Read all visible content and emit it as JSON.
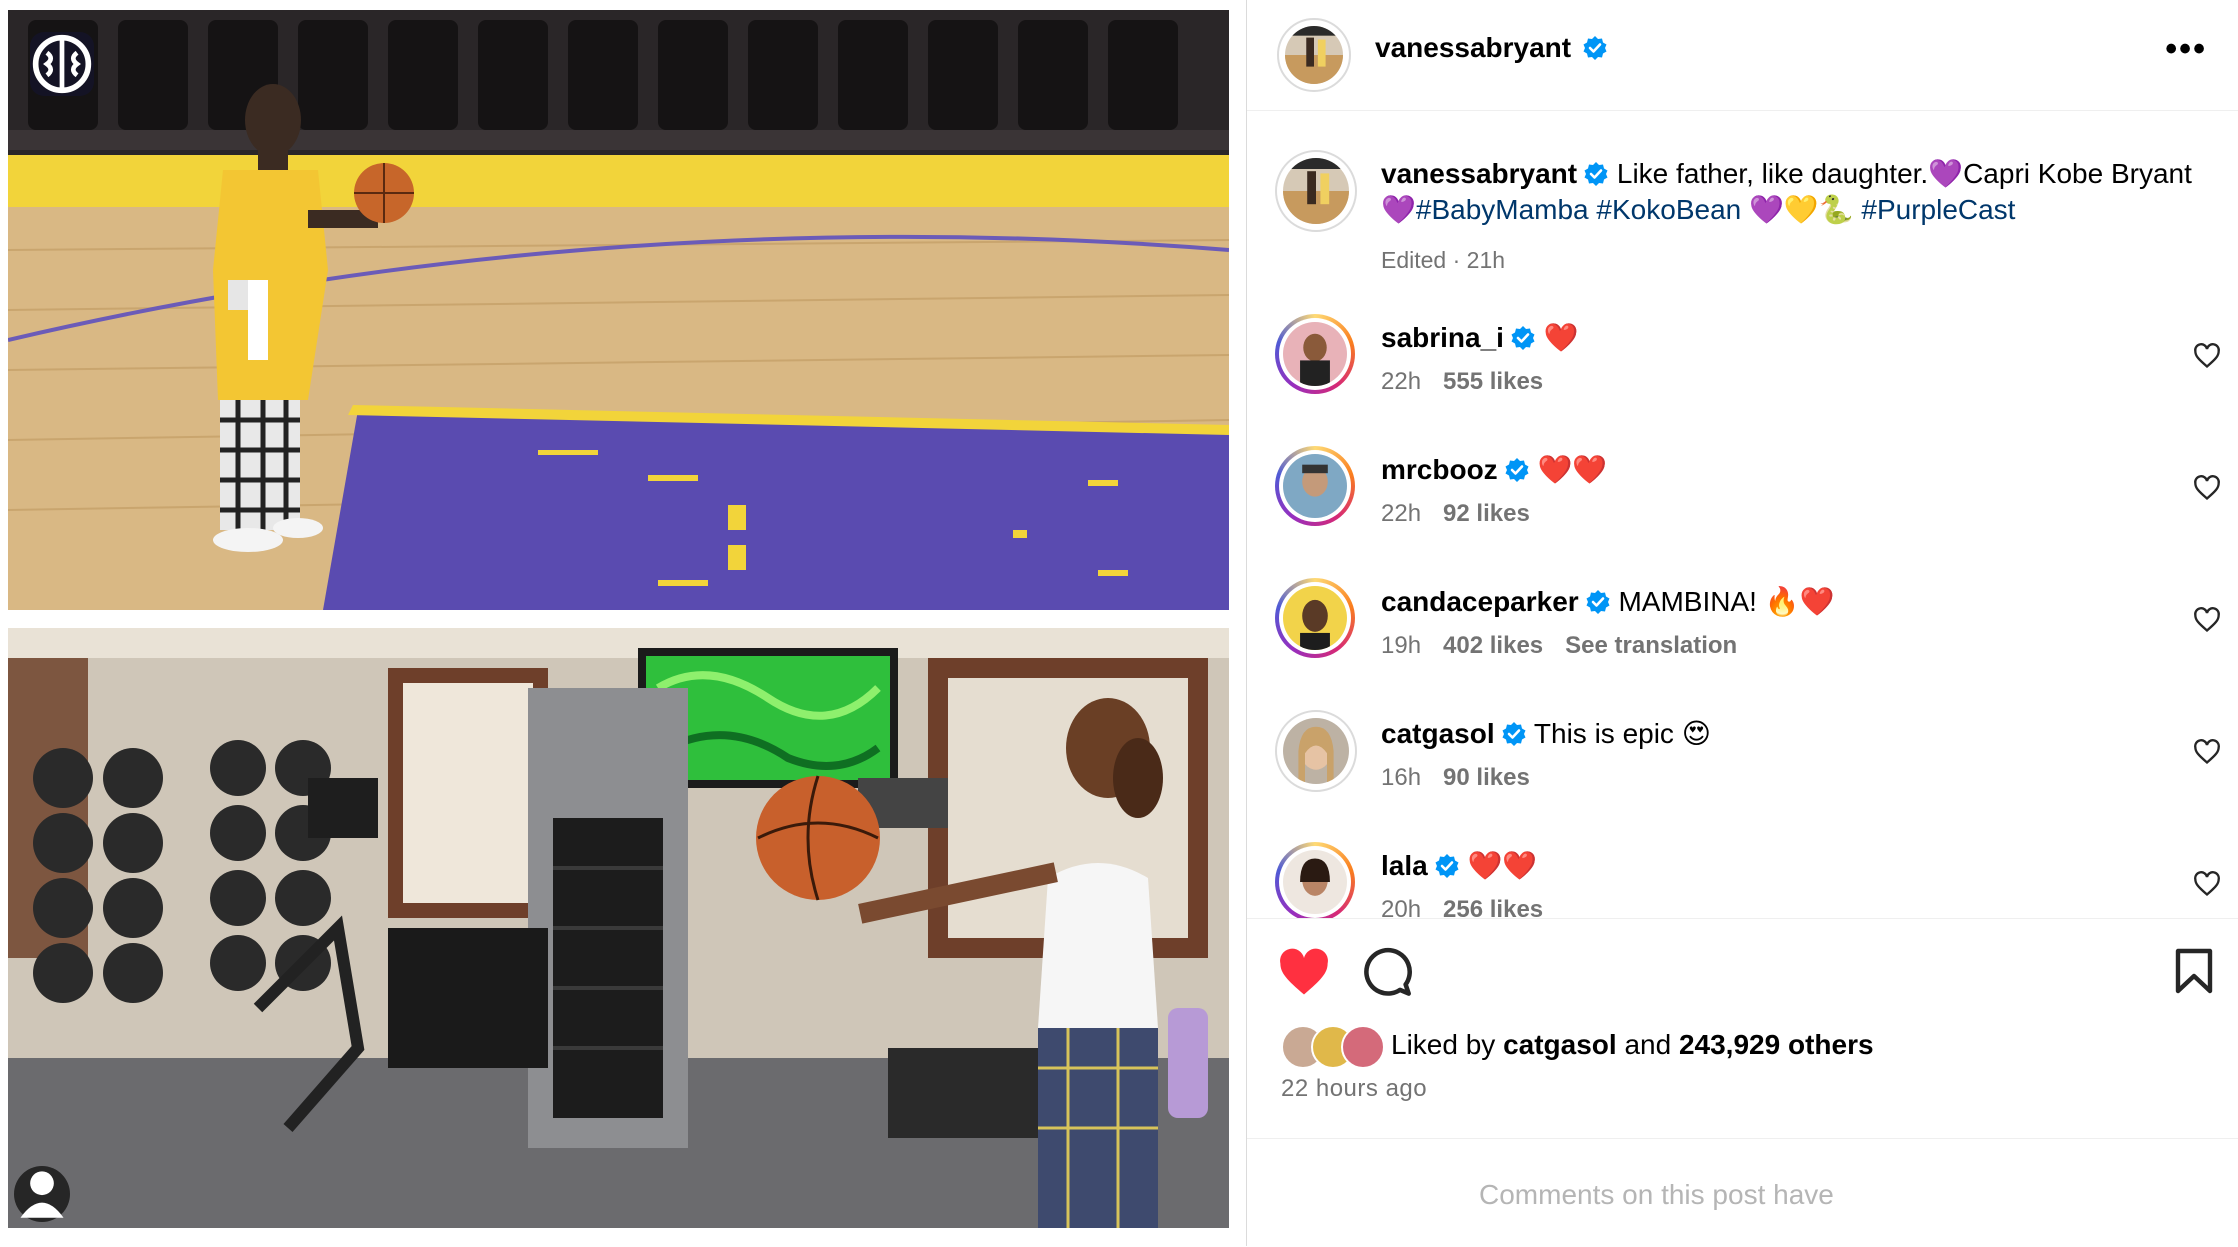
{
  "post": {
    "author": "vanessabryant",
    "caption_text": "Like father, like daughter.💜Capri Kobe Bryant",
    "caption_prefix_emoji": "💜",
    "hashtags": [
      "#BabyMamba",
      "#KokoBean"
    ],
    "caption_emoji_mid": "💜💛🐍",
    "hashtag_last": "#PurpleCast",
    "edited_meta": "Edited · 21h"
  },
  "header": {
    "username": "vanessabryant",
    "more_label": "•••"
  },
  "comments": [
    {
      "username": "sabrina_i",
      "text": "❤️",
      "time": "22h",
      "likes": "555 likes",
      "translation": ""
    },
    {
      "username": "mrcbooz",
      "text": "❤️❤️",
      "time": "22h",
      "likes": "92 likes",
      "translation": ""
    },
    {
      "username": "candaceparker",
      "text": "MAMBINA! 🔥❤️",
      "time": "19h",
      "likes": "402 likes",
      "translation": "See translation"
    },
    {
      "username": "catgasol",
      "text": "This is epic 😍",
      "time": "16h",
      "likes": "90 likes",
      "translation": ""
    },
    {
      "username": "lala",
      "text": "❤️❤️",
      "time": "20h",
      "likes": "256 likes",
      "translation": ""
    }
  ],
  "likes_summary": {
    "prefix": "Liked by",
    "first_liker": "catgasol",
    "and": "and",
    "others": "243,929 others"
  },
  "time_ago": "22 hours ago",
  "comments_disabled_text": "Comments on this post have",
  "icons": {
    "like": "heart-filled-icon",
    "comment": "comment-bubble-icon",
    "save": "bookmark-icon",
    "verified": "verified-badge-icon",
    "comment_like": "heart-outline-icon",
    "user_tags": "person-icon",
    "media_badge": "brain-icon"
  },
  "colors": {
    "like_red": "#ff3040",
    "verified_blue": "#0095f6",
    "hashtag": "#00376b",
    "muted": "#737373"
  }
}
